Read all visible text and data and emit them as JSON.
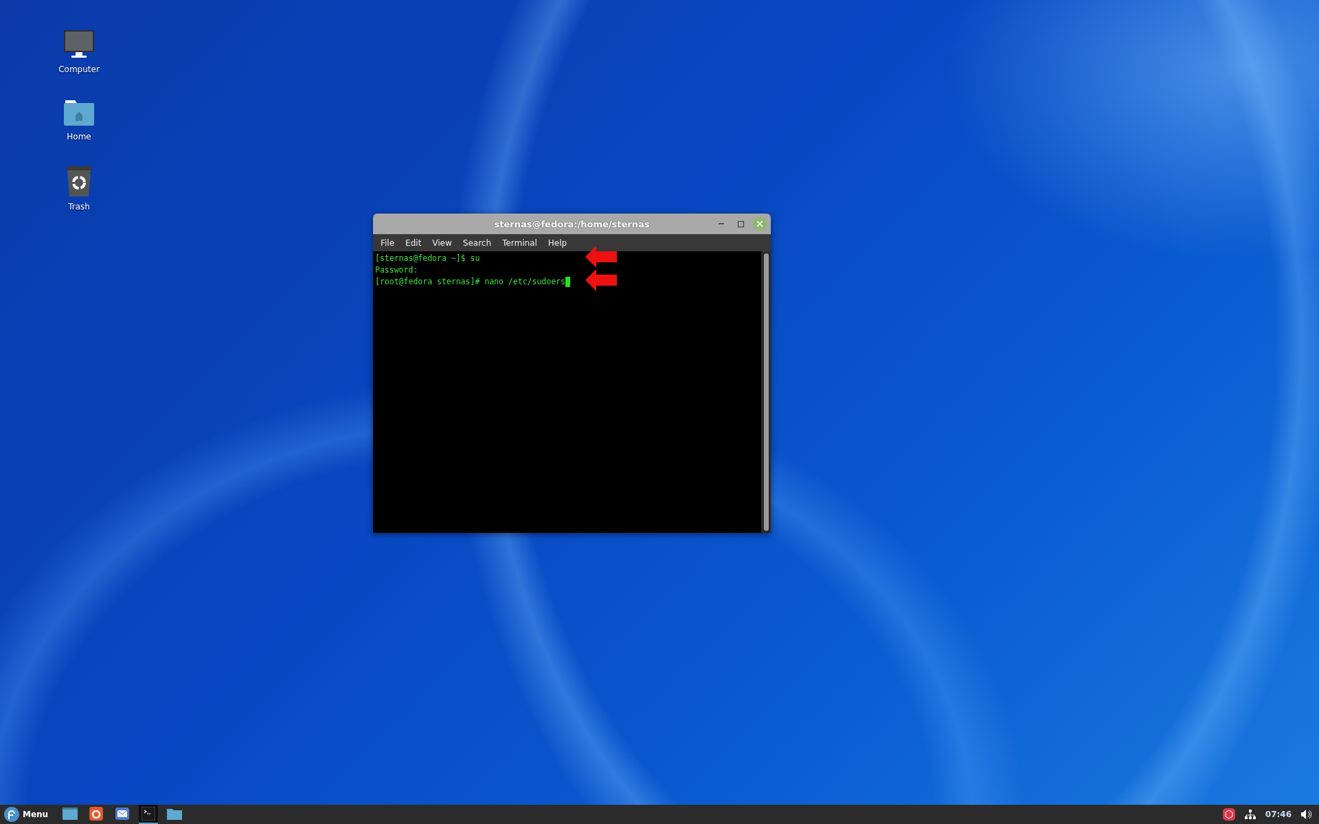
{
  "desktop_icons": [
    {
      "kind": "computer",
      "label": "Computer"
    },
    {
      "kind": "home",
      "label": "Home"
    },
    {
      "kind": "trash",
      "label": "Trash"
    }
  ],
  "window": {
    "title": "sternas@fedora:/home/sternas",
    "menu": [
      "File",
      "Edit",
      "View",
      "Search",
      "Terminal",
      "Help"
    ],
    "lines": [
      {
        "text": "[sternas@fedora ~]$ su",
        "marked": true
      },
      {
        "text": "Password:",
        "marked": false
      },
      {
        "text": "[root@fedora sternas]# nano /etc/sudoers",
        "marked": true
      }
    ]
  },
  "taskbar": {
    "menu_label": "Menu",
    "launchers": [
      {
        "kind": "window",
        "active": false
      },
      {
        "kind": "browser",
        "active": false
      },
      {
        "kind": "mail",
        "active": false
      },
      {
        "kind": "terminal",
        "active": true
      },
      {
        "kind": "folder",
        "active": false
      }
    ],
    "clock": "07:46"
  }
}
